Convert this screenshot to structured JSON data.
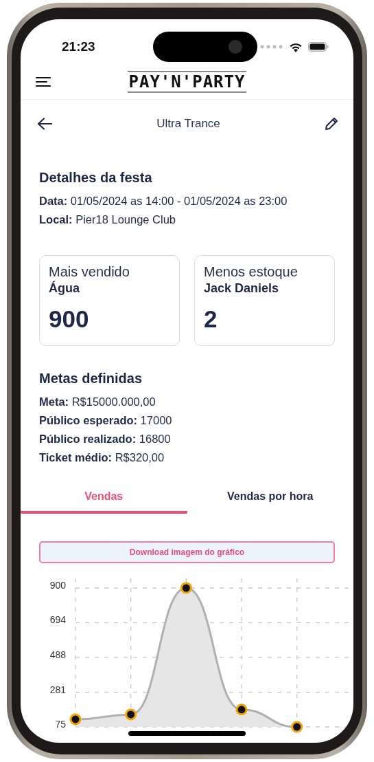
{
  "status_bar": {
    "time": "21:23"
  },
  "header": {
    "logo": "PAY'N'PARTY"
  },
  "page": {
    "title": "Ultra Trance"
  },
  "details": {
    "title": "Detalhes da festa",
    "lines": [
      "**Data:** 01/05/2024 as 14:00 - 01/05/2024 as 23:00",
      "**Local:** Pier18 Lounge Club"
    ]
  },
  "cards": [
    {
      "label": "Mais vendido",
      "item": "Água",
      "value": "900"
    },
    {
      "label": "Menos estoque",
      "item": "Jack Daniels",
      "value": "2"
    }
  ],
  "goals": {
    "title": "Metas definidas",
    "lines": [
      "**Meta:**  R$15000.000,00",
      "**Público esperado:** 17000",
      "**Público realizado:** 16800",
      "**Ticket médio:** R$320,00"
    ]
  },
  "tabs": [
    {
      "label": "Vendas",
      "selected": true
    },
    {
      "label": "Vendas por hora",
      "selected": false
    }
  ],
  "download_button": "Download imagem do gráfico",
  "chart": {
    "chart_data": {
      "type": "area",
      "series": [
        {
          "color": "#e6e6e6",
          "values": [
            120,
            149,
            900,
            178,
            75
          ]
        }
      ],
      "grid": true,
      "ylim": [
        75,
        900
      ],
      "yticks": [
        75,
        281,
        488,
        694,
        900
      ]
    }
  }
}
